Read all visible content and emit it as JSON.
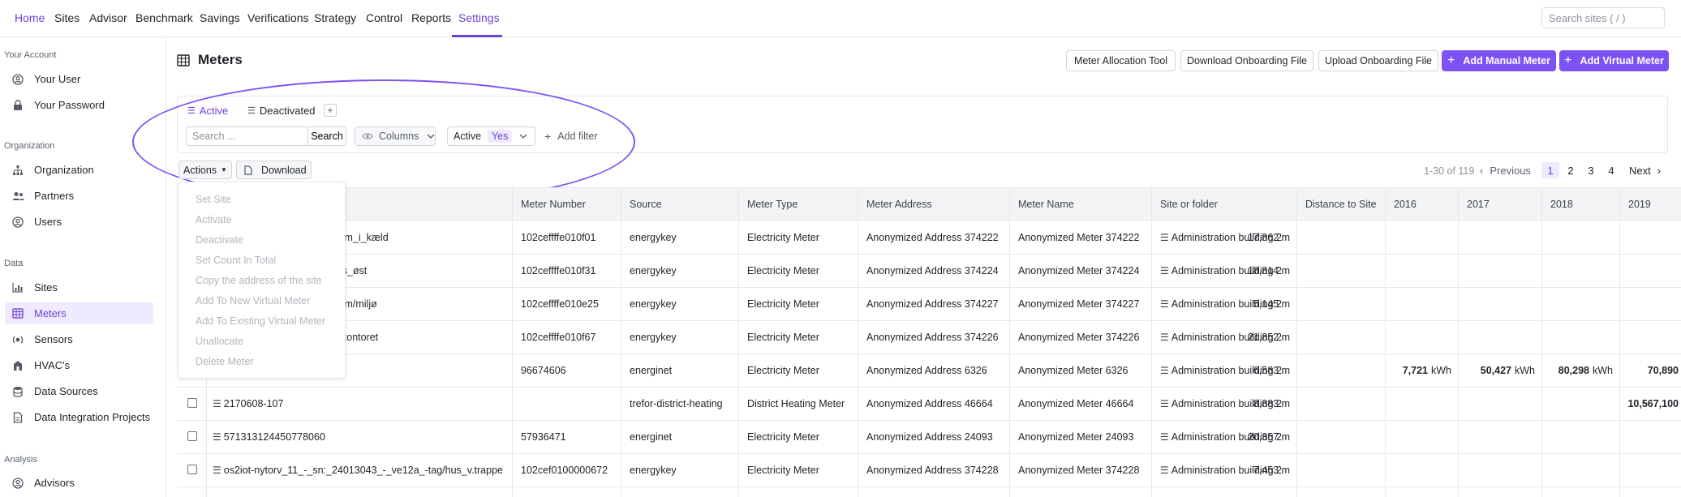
{
  "nav": [
    {
      "label": "Home",
      "active": true
    },
    {
      "label": "Sites"
    },
    {
      "label": "Advisor"
    },
    {
      "label": "Benchmark"
    },
    {
      "label": "Savings"
    },
    {
      "label": "Verifications"
    },
    {
      "label": "Strategy"
    },
    {
      "label": "Control"
    },
    {
      "label": "Reports"
    },
    {
      "label": "Settings",
      "current": true
    }
  ],
  "site_search_placeholder": "Search sites ( / )",
  "sidebar": {
    "sections": [
      "Your Account",
      "Organization",
      "Data",
      "Analysis"
    ],
    "items": [
      {
        "label": "Your User",
        "icon": "user-circle-icon"
      },
      {
        "label": "Your Password",
        "icon": "lock-icon"
      },
      {
        "label": "Organization",
        "icon": "hierarchy-icon"
      },
      {
        "label": "Partners",
        "icon": "users-icon"
      },
      {
        "label": "Users",
        "icon": "user-circle-icon"
      },
      {
        "label": "Sites",
        "icon": "bar-chart-icon"
      },
      {
        "label": "Meters",
        "icon": "table-icon",
        "active": true
      },
      {
        "label": "Sensors",
        "icon": "sensor-icon"
      },
      {
        "label": "HVAC's",
        "icon": "hvac-icon"
      },
      {
        "label": "Data Sources",
        "icon": "database-icon"
      },
      {
        "label": "Data Integration Projects",
        "icon": "document-icon"
      },
      {
        "label": "Advisors",
        "icon": "user-circle-icon"
      }
    ]
  },
  "page": {
    "title": "Meters",
    "buttons": {
      "allocation": "Meter Allocation Tool",
      "download_onboarding": "Download Onboarding File",
      "upload_onboarding": "Upload Onboarding File",
      "add_manual": "Add Manual Meter",
      "add_virtual": "Add Virtual Meter"
    }
  },
  "filters": {
    "tabs": [
      "Active",
      "Deactivated"
    ],
    "add_tab": "+",
    "search_placeholder": "Search ...",
    "search_button": "Search",
    "columns_button": "Columns",
    "status_label": "Active",
    "status_value": "Yes",
    "add_filter": "Add filter"
  },
  "actions": {
    "label": "Actions",
    "download": "Download",
    "menu": [
      "Set Site",
      "Activate",
      "Deactivate",
      "Set Count In Total",
      "Copy the address of the site",
      "Add To New Virtual Meter",
      "Add To Existing Virtual Meter",
      "Unallocate",
      "Delete Meter"
    ]
  },
  "pagination": {
    "range": "1-30 of 119",
    "previous": "Previous",
    "pages": [
      "1",
      "2",
      "3",
      "4"
    ],
    "current": "1",
    "next": "Next"
  },
  "table": {
    "columns": [
      "Meter Number",
      "Source",
      "Meter Type",
      "Meter Address",
      "Meter Name",
      "Site or folder",
      "Distance to Site",
      "2016",
      "2017",
      "2018",
      "2019"
    ],
    "rows": [
      {
        "id": "013097_-_ve15_-_teknikrum_i_kæld",
        "number": "102ceffffe010f01",
        "source": "energykey",
        "type": "Electricity Meter",
        "address": "Anonymized Address 374222",
        "name": "Anonymized Meter 374222",
        "site": "Administration building 2",
        "distance": "17,862 m",
        "y2016": "",
        "y2017": "",
        "y2018": "",
        "y2019": ""
      },
      {
        "id": "013098_-_ve13v_-_tag/hus_øst",
        "number": "102ceffffe010f31",
        "source": "energykey",
        "type": "Electricity Meter",
        "address": "Anonymized Address 374224",
        "name": "Anonymized Meter 374224",
        "site": "Administration building 2",
        "distance": "18,814 m",
        "y2016": "",
        "y2017": "",
        "y2018": "",
        "y2019": ""
      },
      {
        "id": "013100_-_ve01_-_teknikrum/miljø",
        "number": "102ceffffe010e25",
        "source": "energykey",
        "type": "Electricity Meter",
        "address": "Anonymized Address 374227",
        "name": "Anonymized Meter 374227",
        "site": "Administration building 2",
        "distance": "5,145 m",
        "y2016": "",
        "y2017": "",
        "y2018": "",
        "y2019": ""
      },
      {
        "id": "013082_-_ve21_-_kørselskontoret",
        "number": "102ceffffe010f67",
        "source": "energykey",
        "type": "Electricity Meter",
        "address": "Anonymized Address 374226",
        "name": "Anonymized Meter 374226",
        "site": "Administration building 2",
        "distance": "21,852 m",
        "y2016": "",
        "y2017": "",
        "y2018": "",
        "y2019": ""
      },
      {
        "id": "",
        "number": "96674606",
        "source": "energinet",
        "type": "Electricity Meter",
        "address": "Anonymized Address 6326",
        "name": "Anonymized Meter 6326",
        "site": "Administration building 2",
        "distance": "6,583 m",
        "y2016": "7,721",
        "y2017": "50,427",
        "y2018": "80,298",
        "y2019": "70,890"
      },
      {
        "id": "2170608-107",
        "number": "",
        "source": "trefor-district-heating",
        "type": "District Heating Meter",
        "address": "Anonymized Address 46664",
        "name": "Anonymized Meter 46664",
        "site": "Administration building 2",
        "distance": "8,883 m",
        "y2016": "",
        "y2017": "",
        "y2018": "",
        "y2019": "10,567,100"
      },
      {
        "id": "571313124450778060",
        "number": "57936471",
        "source": "energinet",
        "type": "Electricity Meter",
        "address": "Anonymized Address 24093",
        "name": "Anonymized Meter 24093",
        "site": "Administration building 2",
        "distance": "20,357 m",
        "y2016": "",
        "y2017": "",
        "y2018": "",
        "y2019": ""
      },
      {
        "id": "os2iot-nytorv_11_-_sn:_24013043_-_ve12a_-tag/hus_v.trappe",
        "number": "102cef0100000672",
        "source": "energykey",
        "type": "Electricity Meter",
        "address": "Anonymized Address 374228",
        "name": "Anonymized Meter 374228",
        "site": "Administration building 2",
        "distance": "7,453 m",
        "y2016": "",
        "y2017": "",
        "y2018": "",
        "y2019": ""
      }
    ],
    "unit": "kWh"
  },
  "colors": {
    "accent": "#7d52f4",
    "accent_text": "#6d42d9",
    "accent_bg": "#efeaff"
  }
}
